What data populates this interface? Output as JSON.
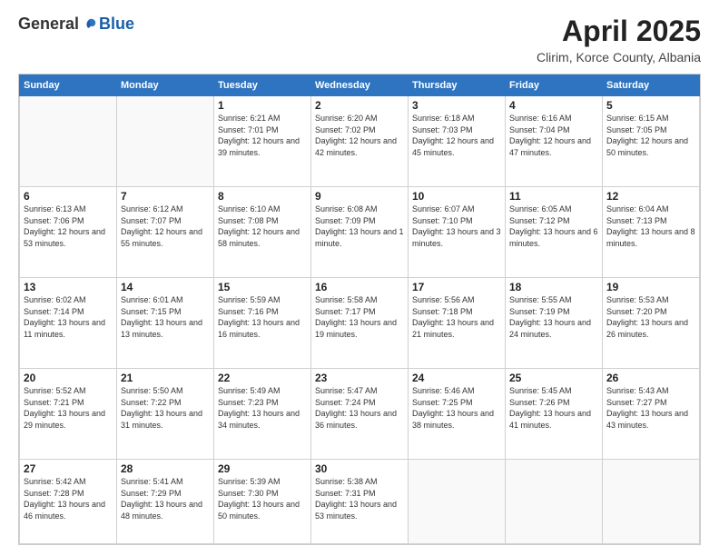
{
  "logo": {
    "general": "General",
    "blue": "Blue"
  },
  "title": "April 2025",
  "location": "Clirim, Korce County, Albania",
  "days_header": [
    "Sunday",
    "Monday",
    "Tuesday",
    "Wednesday",
    "Thursday",
    "Friday",
    "Saturday"
  ],
  "weeks": [
    [
      {
        "day": "",
        "info": ""
      },
      {
        "day": "",
        "info": ""
      },
      {
        "day": "1",
        "info": "Sunrise: 6:21 AM\nSunset: 7:01 PM\nDaylight: 12 hours\nand 39 minutes."
      },
      {
        "day": "2",
        "info": "Sunrise: 6:20 AM\nSunset: 7:02 PM\nDaylight: 12 hours\nand 42 minutes."
      },
      {
        "day": "3",
        "info": "Sunrise: 6:18 AM\nSunset: 7:03 PM\nDaylight: 12 hours\nand 45 minutes."
      },
      {
        "day": "4",
        "info": "Sunrise: 6:16 AM\nSunset: 7:04 PM\nDaylight: 12 hours\nand 47 minutes."
      },
      {
        "day": "5",
        "info": "Sunrise: 6:15 AM\nSunset: 7:05 PM\nDaylight: 12 hours\nand 50 minutes."
      }
    ],
    [
      {
        "day": "6",
        "info": "Sunrise: 6:13 AM\nSunset: 7:06 PM\nDaylight: 12 hours\nand 53 minutes."
      },
      {
        "day": "7",
        "info": "Sunrise: 6:12 AM\nSunset: 7:07 PM\nDaylight: 12 hours\nand 55 minutes."
      },
      {
        "day": "8",
        "info": "Sunrise: 6:10 AM\nSunset: 7:08 PM\nDaylight: 12 hours\nand 58 minutes."
      },
      {
        "day": "9",
        "info": "Sunrise: 6:08 AM\nSunset: 7:09 PM\nDaylight: 13 hours\nand 1 minute."
      },
      {
        "day": "10",
        "info": "Sunrise: 6:07 AM\nSunset: 7:10 PM\nDaylight: 13 hours\nand 3 minutes."
      },
      {
        "day": "11",
        "info": "Sunrise: 6:05 AM\nSunset: 7:12 PM\nDaylight: 13 hours\nand 6 minutes."
      },
      {
        "day": "12",
        "info": "Sunrise: 6:04 AM\nSunset: 7:13 PM\nDaylight: 13 hours\nand 8 minutes."
      }
    ],
    [
      {
        "day": "13",
        "info": "Sunrise: 6:02 AM\nSunset: 7:14 PM\nDaylight: 13 hours\nand 11 minutes."
      },
      {
        "day": "14",
        "info": "Sunrise: 6:01 AM\nSunset: 7:15 PM\nDaylight: 13 hours\nand 13 minutes."
      },
      {
        "day": "15",
        "info": "Sunrise: 5:59 AM\nSunset: 7:16 PM\nDaylight: 13 hours\nand 16 minutes."
      },
      {
        "day": "16",
        "info": "Sunrise: 5:58 AM\nSunset: 7:17 PM\nDaylight: 13 hours\nand 19 minutes."
      },
      {
        "day": "17",
        "info": "Sunrise: 5:56 AM\nSunset: 7:18 PM\nDaylight: 13 hours\nand 21 minutes."
      },
      {
        "day": "18",
        "info": "Sunrise: 5:55 AM\nSunset: 7:19 PM\nDaylight: 13 hours\nand 24 minutes."
      },
      {
        "day": "19",
        "info": "Sunrise: 5:53 AM\nSunset: 7:20 PM\nDaylight: 13 hours\nand 26 minutes."
      }
    ],
    [
      {
        "day": "20",
        "info": "Sunrise: 5:52 AM\nSunset: 7:21 PM\nDaylight: 13 hours\nand 29 minutes."
      },
      {
        "day": "21",
        "info": "Sunrise: 5:50 AM\nSunset: 7:22 PM\nDaylight: 13 hours\nand 31 minutes."
      },
      {
        "day": "22",
        "info": "Sunrise: 5:49 AM\nSunset: 7:23 PM\nDaylight: 13 hours\nand 34 minutes."
      },
      {
        "day": "23",
        "info": "Sunrise: 5:47 AM\nSunset: 7:24 PM\nDaylight: 13 hours\nand 36 minutes."
      },
      {
        "day": "24",
        "info": "Sunrise: 5:46 AM\nSunset: 7:25 PM\nDaylight: 13 hours\nand 38 minutes."
      },
      {
        "day": "25",
        "info": "Sunrise: 5:45 AM\nSunset: 7:26 PM\nDaylight: 13 hours\nand 41 minutes."
      },
      {
        "day": "26",
        "info": "Sunrise: 5:43 AM\nSunset: 7:27 PM\nDaylight: 13 hours\nand 43 minutes."
      }
    ],
    [
      {
        "day": "27",
        "info": "Sunrise: 5:42 AM\nSunset: 7:28 PM\nDaylight: 13 hours\nand 46 minutes."
      },
      {
        "day": "28",
        "info": "Sunrise: 5:41 AM\nSunset: 7:29 PM\nDaylight: 13 hours\nand 48 minutes."
      },
      {
        "day": "29",
        "info": "Sunrise: 5:39 AM\nSunset: 7:30 PM\nDaylight: 13 hours\nand 50 minutes."
      },
      {
        "day": "30",
        "info": "Sunrise: 5:38 AM\nSunset: 7:31 PM\nDaylight: 13 hours\nand 53 minutes."
      },
      {
        "day": "",
        "info": ""
      },
      {
        "day": "",
        "info": ""
      },
      {
        "day": "",
        "info": ""
      }
    ]
  ]
}
